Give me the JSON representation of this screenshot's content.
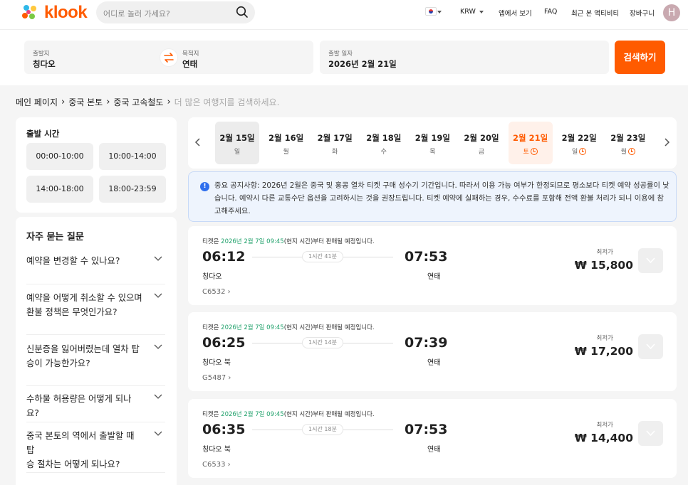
{
  "header": {
    "logo_text": "klook",
    "search_placeholder": "어디로 놀러 가세요?",
    "currency": "KRW",
    "nav": [
      "앱에서 보기",
      "FAQ",
      "최근 본 액티비티",
      "장바구니"
    ],
    "avatar_letter": "H"
  },
  "search": {
    "from_label": "출발지",
    "from_value": "칭다오",
    "to_label": "목적지",
    "to_value": "연태",
    "date_label": "출발 일자",
    "date_value": "2026년 2월 21일",
    "button": "검색하기"
  },
  "breadcrumb": [
    "메인 페이지",
    "중국 본토",
    "중국 고속철도",
    "더 많은 여행지를 검색하세요."
  ],
  "departure_time": {
    "title": "출발 시간",
    "slots": [
      "00:00-10:00",
      "10:00-14:00",
      "14:00-18:00",
      "18:00-23:59"
    ]
  },
  "faq": {
    "title": "자주 묻는 질문",
    "items": [
      {
        "line1": "예약을 변경할 수 있나요?",
        "line2": ""
      },
      {
        "line1": "예약을 어떻게 취소할 수 있으며",
        "line2": "환불 정책은 무엇인가요?"
      },
      {
        "line1": "신분증을 잃어버렸는데 열차 탑",
        "line2": "승이 가능한가요?"
      },
      {
        "line1": "수하물 허용량은 어떻게 되나요?",
        "line2": ""
      },
      {
        "line1": "중국 본토의 역에서 출발할 때 탑",
        "line2": "승 절차는 어떻게 되나요?"
      }
    ]
  },
  "dates": [
    {
      "date": "2월 15일",
      "day": "일",
      "state": "selected",
      "clock": false
    },
    {
      "date": "2월 16일",
      "day": "월",
      "state": "",
      "clock": false
    },
    {
      "date": "2월 17일",
      "day": "화",
      "state": "",
      "clock": false
    },
    {
      "date": "2월 18일",
      "day": "수",
      "state": "",
      "clock": false
    },
    {
      "date": "2월 19일",
      "day": "목",
      "state": "",
      "clock": false
    },
    {
      "date": "2월 20일",
      "day": "금",
      "state": "",
      "clock": false
    },
    {
      "date": "2월 21일",
      "day": "토",
      "state": "highlight",
      "clock": true
    },
    {
      "date": "2월 22일",
      "day": "일",
      "state": "",
      "clock": true
    },
    {
      "date": "2월 23일",
      "day": "월",
      "state": "",
      "clock": true
    }
  ],
  "notice": {
    "text": "중요 공지사항: 2026년 2월은 중국 및 홍콩 열차 티켓 구매 성수기 기간입니다. 따라서 이용 가능 여부가 한정되므로 평소보다 티켓 예약 성공률이 낮습니다. 예약시 다른 교통수단 옵션을 고려하시는 것을 권장드립니다. 티켓 예약에 실패하는 경우, 수수료를 포함해 전액 환불 처리가 되니 이용에 참고해주세요."
  },
  "sale": {
    "prefix": "티켓은 ",
    "date": "2026년 2월 7일 09:45",
    "suffix": "(현지 시간)부터 판매될 예정입니다."
  },
  "price_label": "최저가",
  "trains": [
    {
      "dep": "06:12",
      "arr": "07:53",
      "duration": "1시간 41분",
      "from": "칭다오",
      "to": "연태",
      "number": "C6532",
      "price": "₩ 15,800"
    },
    {
      "dep": "06:25",
      "arr": "07:39",
      "duration": "1시간 14분",
      "from": "칭다오 북",
      "to": "연태",
      "number": "G5487",
      "price": "₩ 17,200"
    },
    {
      "dep": "06:35",
      "arr": "07:53",
      "duration": "1시간 18분",
      "from": "칭다오 북",
      "to": "연태",
      "number": "C6533",
      "price": "₩ 14,400"
    }
  ],
  "colors": {
    "brand": "#ff5b00",
    "sale_date": "#20a16b",
    "notice_icon": "#2f6fed"
  }
}
